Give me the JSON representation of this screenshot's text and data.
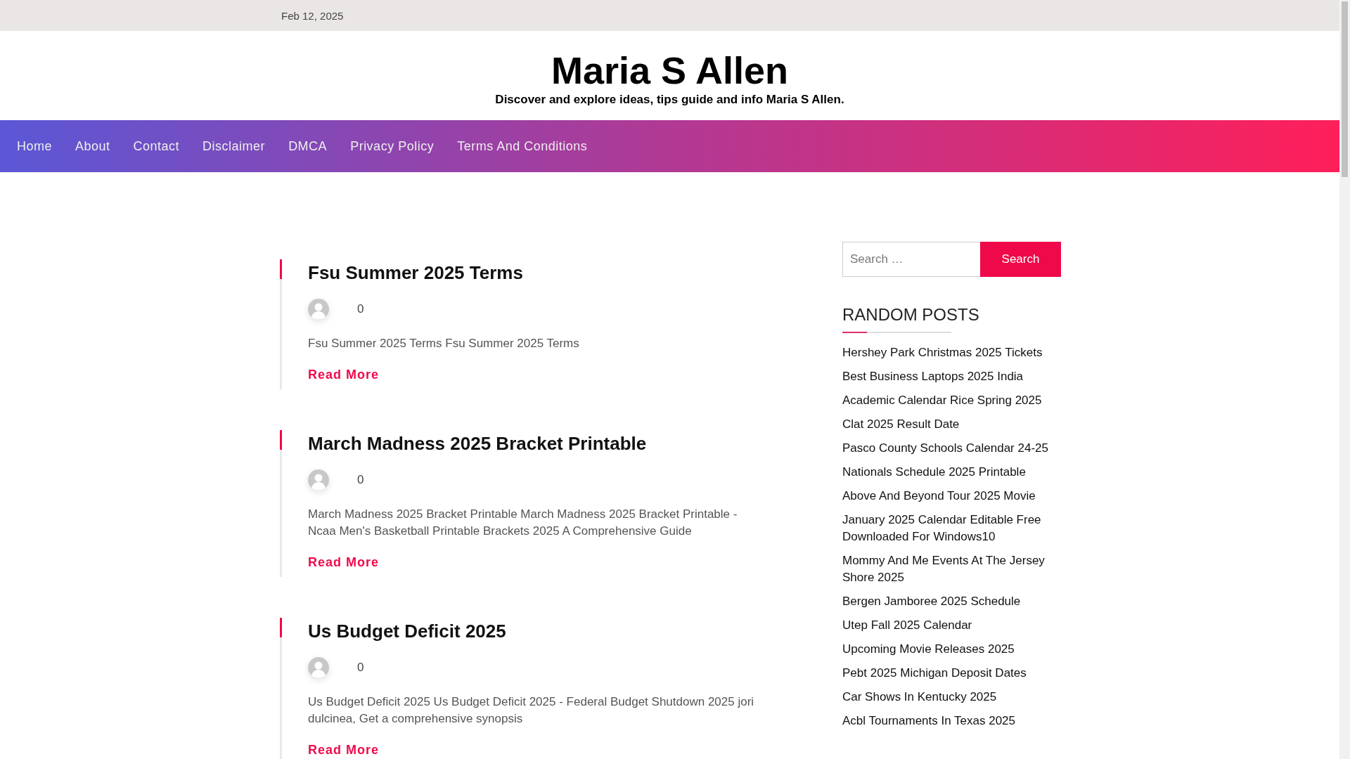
{
  "top_bar": {
    "date": "Feb 12, 2025"
  },
  "header": {
    "site_title": "Maria S Allen",
    "tagline": "Discover and explore ideas, tips guide and info Maria S Allen."
  },
  "nav": {
    "items": [
      {
        "label": "Home"
      },
      {
        "label": "About"
      },
      {
        "label": "Contact"
      },
      {
        "label": "Disclaimer"
      },
      {
        "label": "DMCA"
      },
      {
        "label": "Privacy Policy"
      },
      {
        "label": "Terms And Conditions"
      }
    ]
  },
  "posts": [
    {
      "title": "Fsu Summer 2025 Terms",
      "comments": "0",
      "excerpt": "Fsu Summer 2025 Terms Fsu Summer 2025 Terms",
      "read_more": "Read More"
    },
    {
      "title": "March Madness 2025 Bracket Printable",
      "comments": "0",
      "excerpt": "March Madness 2025 Bracket Printable March Madness 2025 Bracket Printable - Ncaa Men's Basketball Printable Brackets 2025 A Comprehensive Guide",
      "read_more": "Read More"
    },
    {
      "title": "Us Budget Deficit 2025",
      "comments": "0",
      "excerpt": "Us Budget Deficit 2025 Us Budget Deficit 2025 - Federal Budget Shutdown 2025 jori dulcinea, Get a comprehensive synopsis",
      "read_more": "Read More"
    }
  ],
  "sidebar": {
    "search": {
      "placeholder": "Search …",
      "button": "Search"
    },
    "random_posts": {
      "heading": "RANDOM POSTS",
      "items": [
        "Hershey Park Christmas 2025 Tickets",
        "Best Business Laptops 2025 India",
        "Academic Calendar Rice Spring 2025",
        "Clat 2025 Result Date",
        "Pasco County Schools Calendar 24-25",
        "Nationals Schedule 2025 Printable",
        "Above And Beyond Tour 2025 Movie",
        "January 2025 Calendar Editable Free Downloaded For Windows10",
        "Mommy And Me Events At The Jersey Shore 2025",
        "Bergen Jamboree 2025 Schedule",
        "Utep Fall 2025 Calendar",
        "Upcoming Movie Releases 2025",
        "Pebt 2025 Michigan Deposit Dates",
        "Car Shows In Kentucky 2025",
        "Acbl Tournaments In Texas 2025"
      ]
    }
  }
}
